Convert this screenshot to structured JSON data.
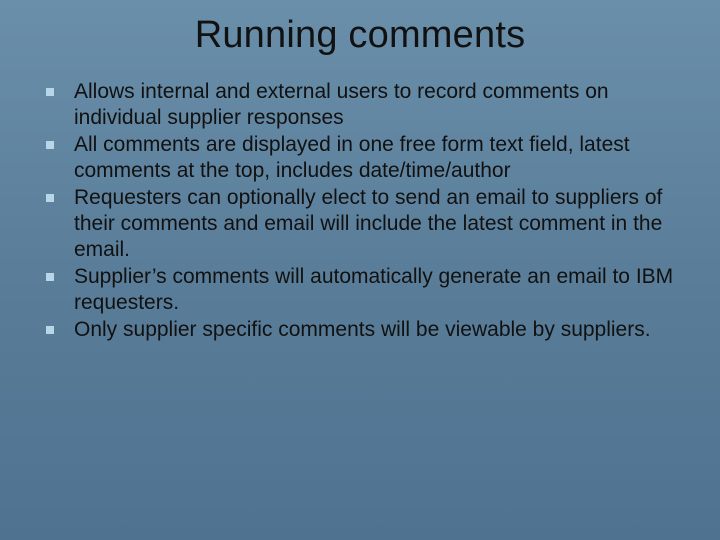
{
  "slide": {
    "title": "Running comments",
    "bullets": [
      "Allows internal and external users to record comments on individual supplier responses",
      "All comments are displayed in one free form text field, latest comments at the top, includes date/time/author",
      "Requesters can optionally elect to send an email to suppliers of their comments and email will include the latest comment in the email.",
      "Supplier’s comments will automatically generate an email to IBM requesters.",
      "Only supplier specific comments will be viewable by suppliers."
    ]
  }
}
